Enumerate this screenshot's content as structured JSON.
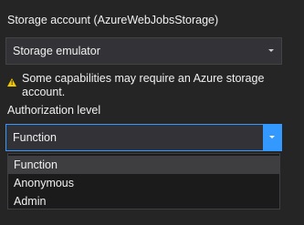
{
  "storage": {
    "label": "Storage account (AzureWebJobsStorage)",
    "selected": "Storage emulator"
  },
  "warning": {
    "icon": "warning-icon",
    "text": "Some capabilities may require an Azure storage account."
  },
  "authorization": {
    "label": "Authorization level",
    "selected": "Function",
    "options": [
      "Function",
      "Anonymous",
      "Admin"
    ]
  },
  "colors": {
    "background": "#252526",
    "accent": "#3399ff",
    "warning": "#f0c800"
  }
}
